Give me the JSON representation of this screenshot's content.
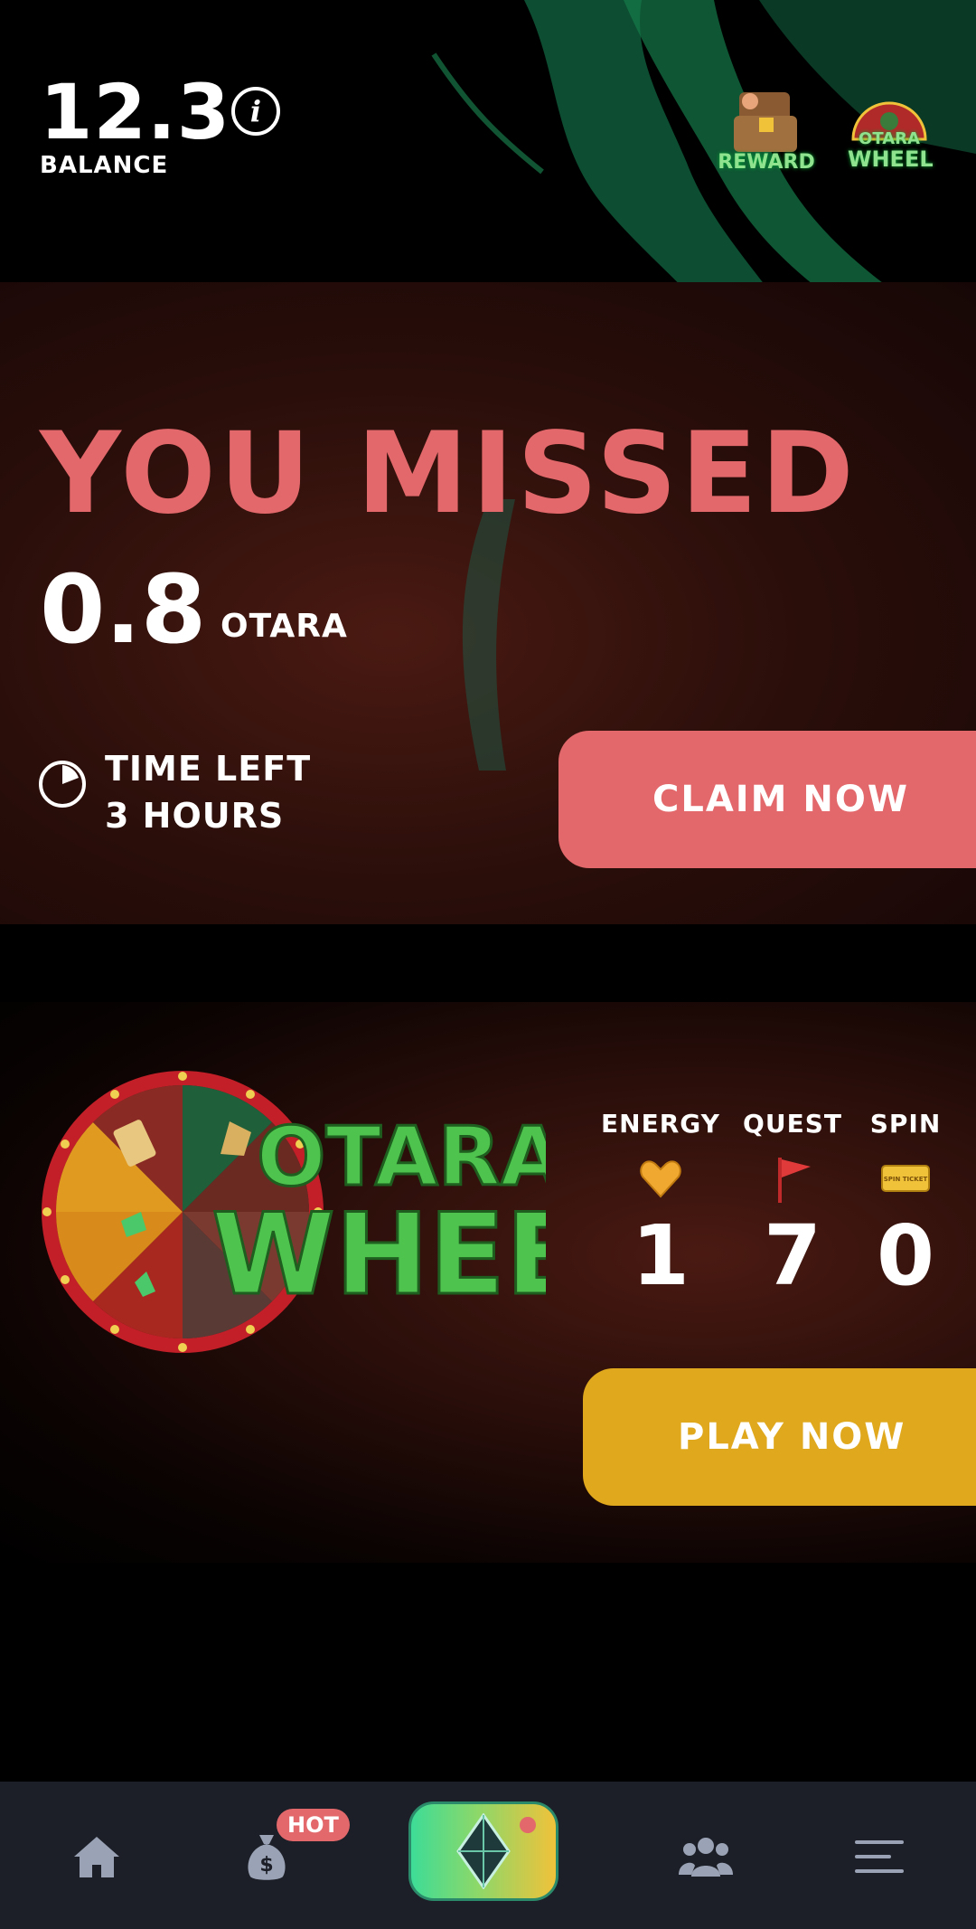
{
  "header": {
    "balance_value": "12.3",
    "balance_label": "BALANCE",
    "info_glyph": "i",
    "reward_label": "REWARD",
    "wheel_label_top": "OTARA",
    "wheel_label_bottom": "WHEEL"
  },
  "missed": {
    "title": "YOU MISSED",
    "amount": "0.8",
    "unit": "OTARA",
    "time_left_label": "TIME LEFT",
    "time_left_value": "3 HOURS",
    "claim_label": "CLAIM NOW"
  },
  "wheel_game": {
    "logo_top": "OTARA",
    "logo_bottom": "WHEEL",
    "stats": [
      {
        "label": "ENERGY",
        "value": "1",
        "icon": "heart-gem-icon"
      },
      {
        "label": "QUEST",
        "value": "7",
        "icon": "flag-icon"
      },
      {
        "label": "SPIN",
        "value": "0",
        "icon": "spin-ticket-icon"
      }
    ],
    "ticket_text": "SPIN TICKET",
    "play_label": "PLAY NOW"
  },
  "nav": {
    "items": [
      {
        "name": "home",
        "icon": "home-icon"
      },
      {
        "name": "earn",
        "icon": "money-bag-icon",
        "badge": "HOT"
      },
      {
        "name": "main",
        "icon": "diamond-icon"
      },
      {
        "name": "friends",
        "icon": "users-icon"
      },
      {
        "name": "menu",
        "icon": "menu-icon"
      }
    ]
  },
  "colors": {
    "accent_red": "#e2686b",
    "accent_gold": "#e0a81c",
    "nav_bg": "#1c1f27",
    "panel_dark_red": "#2a0e0a"
  }
}
